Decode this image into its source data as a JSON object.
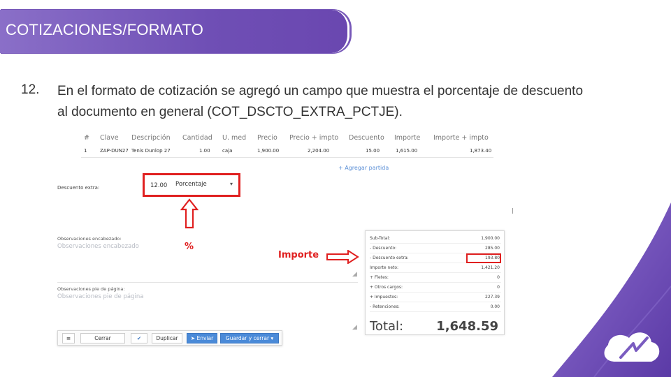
{
  "title": "COTIZACIONES/FORMATO",
  "bullet": {
    "number": "12.",
    "text": "En el formato de cotización se agregó un campo que muestra el porcentaje de descuento al documento en general (COT_DSCTO_EXTRA_PCTJE)."
  },
  "table": {
    "headers": [
      "#",
      "Clave",
      "Descripción",
      "Cantidad",
      "U. med",
      "Precio",
      "Precio + impto",
      "Descuento",
      "Importe",
      "Importe + impto"
    ],
    "row": [
      "1",
      "ZAP-DUN27",
      "Tenis Dunlop 27",
      "1.00",
      "caja",
      "1,900.00",
      "2,204.00",
      "15.00",
      "1,615.00",
      "1,873.40"
    ],
    "add_link": "+ Agregar partida"
  },
  "descuento": {
    "label": "Descuento extra:",
    "value": "12.00",
    "type": "Porcentaje"
  },
  "annotations": {
    "percent": "%",
    "importe": "Importe"
  },
  "observaciones": {
    "enc_label": "Observaciones encabezado:",
    "enc_placeholder": "Observaciones encabezado",
    "pie_label": "Observaciones pie de página:",
    "pie_placeholder": "Observaciones pie de página"
  },
  "totals": {
    "rows": [
      {
        "label": "Sub-Total:",
        "value": "1,900.00"
      },
      {
        "label": "- Descuento:",
        "value": "285.00"
      },
      {
        "label": "- Descuento extra:",
        "value": "193.80"
      },
      {
        "label": "Importe neto:",
        "value": "1,421.20"
      },
      {
        "label": "+ Fletes:",
        "value": "0"
      },
      {
        "label": "+ Otros cargos:",
        "value": "0"
      },
      {
        "label": "+ Impuestos:",
        "value": "227.39"
      },
      {
        "label": "- Retenciones:",
        "value": "0.00"
      }
    ],
    "total_label": "Total:",
    "total_value": "1,648.59"
  },
  "toolbar": {
    "cerrar": "Cerrar",
    "duplicar": "Duplicar",
    "enviar": "Enviar",
    "guardar": "Guardar y cerrar"
  },
  "colors": {
    "banner": "#6f4fb5",
    "highlight": "#e02020",
    "button_blue": "#4a8ad8"
  }
}
